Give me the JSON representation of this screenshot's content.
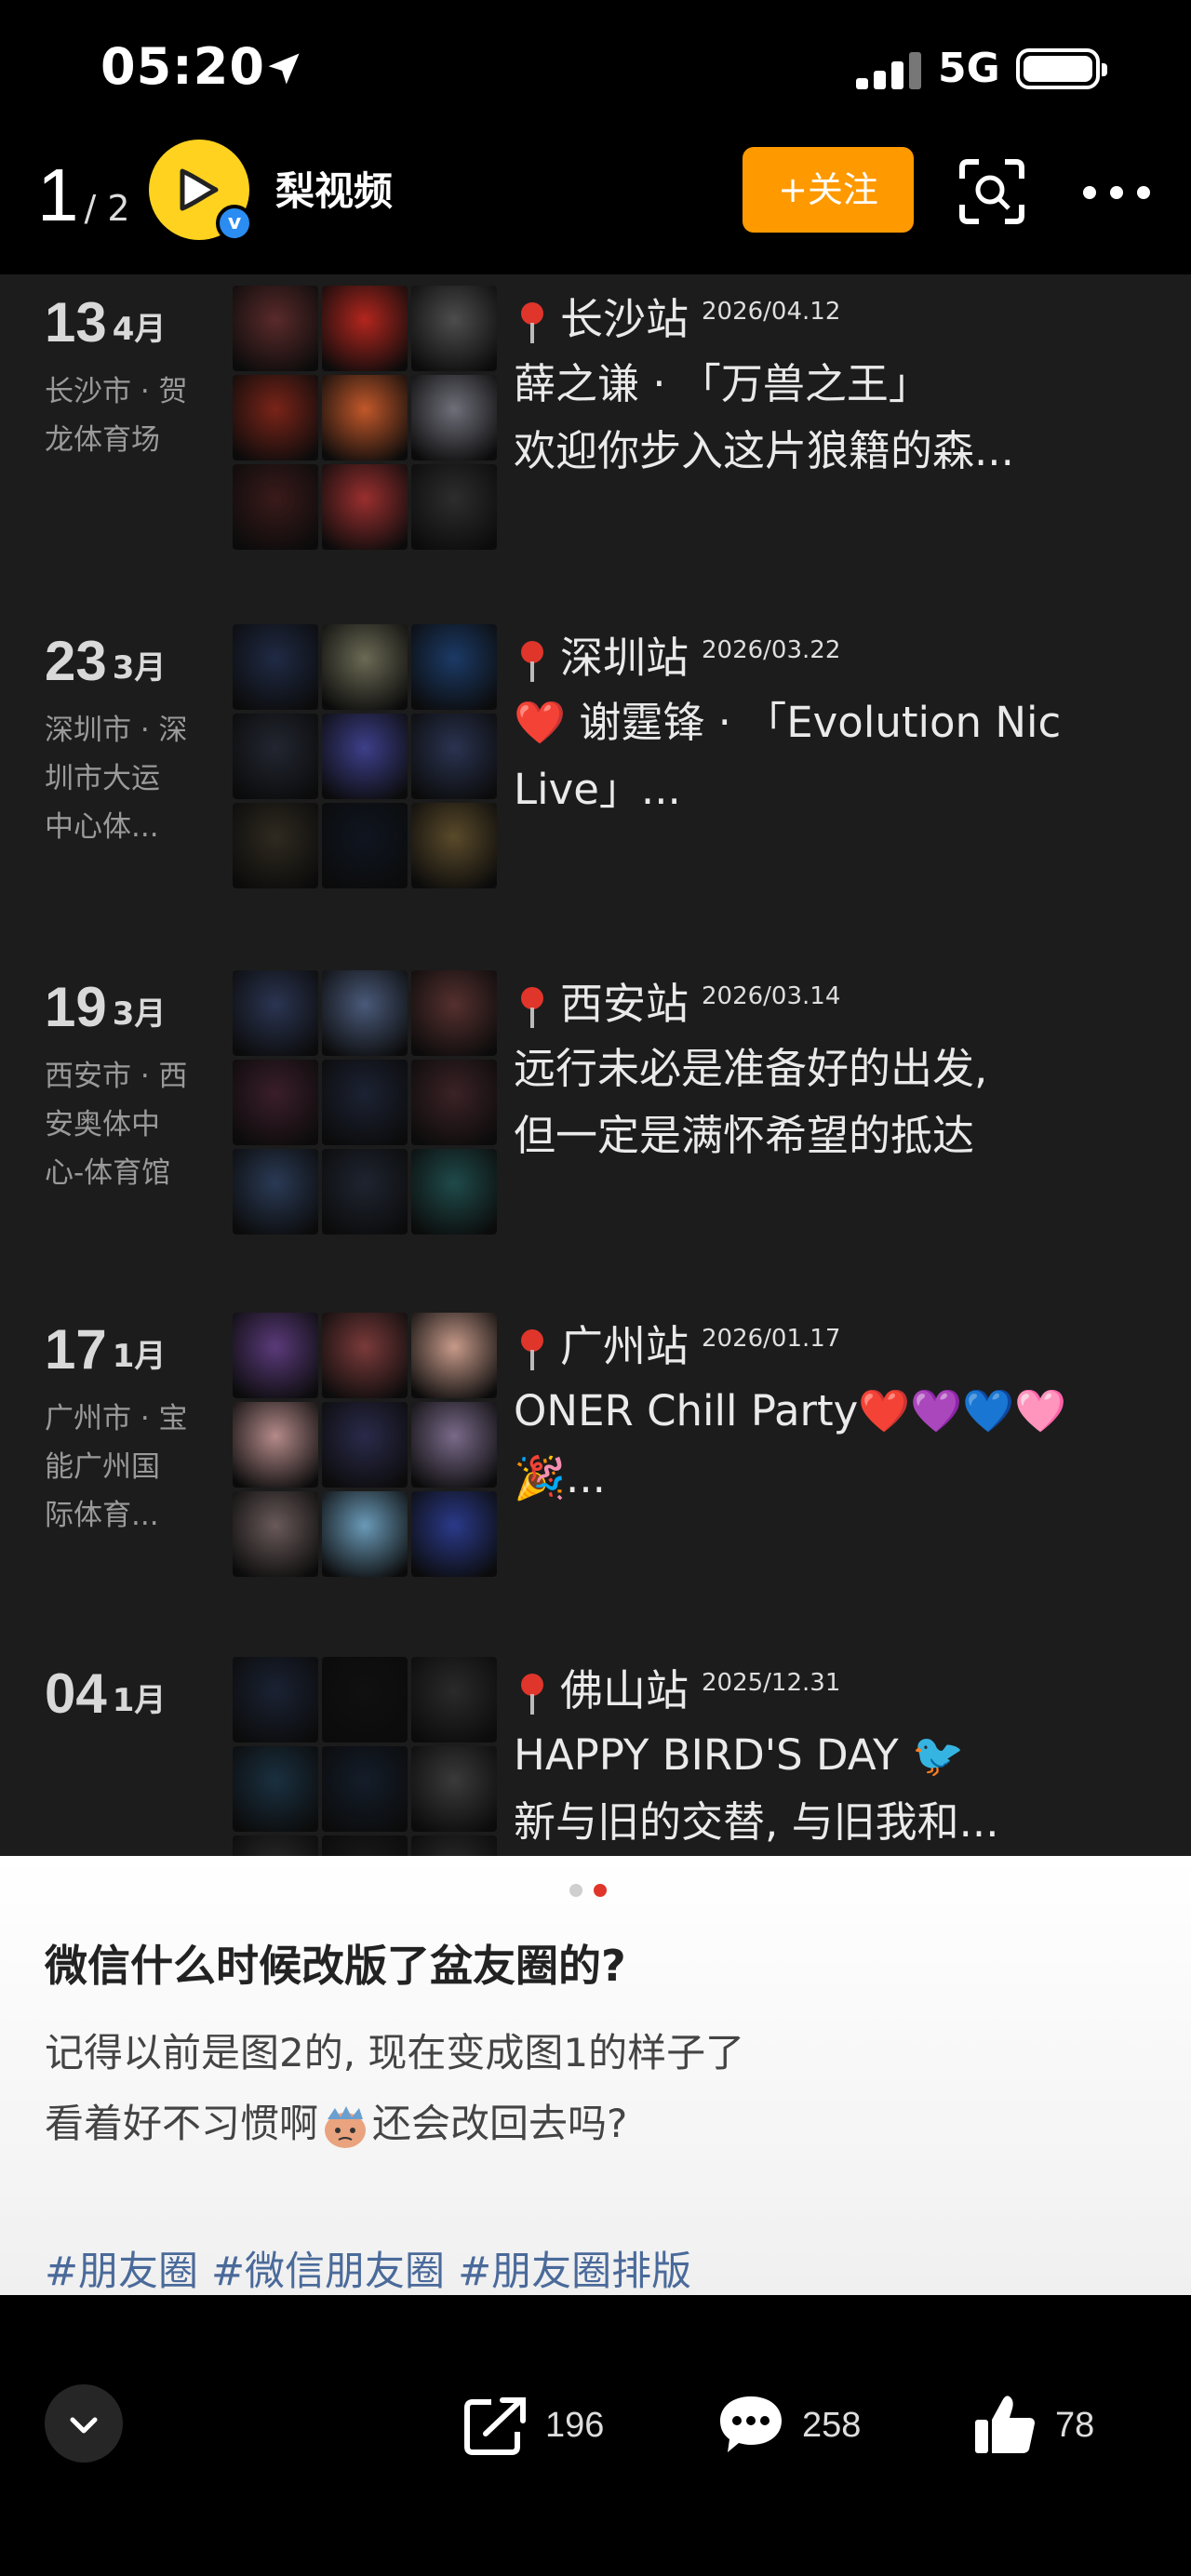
{
  "status_bar": {
    "time": "05:20",
    "network": "5G"
  },
  "header": {
    "page_current": "1",
    "page_total": "/ 2",
    "channel_name": "梨视频",
    "verified_mark": "v",
    "follow_label": "+关注"
  },
  "entries": [
    {
      "day": "13",
      "month": "4月",
      "venue": [
        "长沙市 · 贺",
        "龙体育场"
      ],
      "city_label": "长沙站",
      "stamp": "2026/04.12",
      "lines": [
        "薛之谦 · 「万兽之王」",
        "欢迎你步入这片狼籍的森..."
      ],
      "colors": [
        "#5a2a2a",
        "#b3261e",
        "#4d4d4d",
        "#7a2418",
        "#c2582a",
        "#6f6f7a",
        "#3a1a1a",
        "#9a2f2f",
        "#2d2d2d"
      ]
    },
    {
      "day": "23",
      "month": "3月",
      "venue": [
        "深圳市 · 深",
        "圳市大运",
        "中心体..."
      ],
      "city_label": "深圳站",
      "stamp": "2026/03.22",
      "lines": [
        "❤️ 谢霆锋 · 「Evolution Nic",
        "Live」..."
      ],
      "colors": [
        "#1f2a44",
        "#6b6a55",
        "#1b3a66",
        "#222631",
        "#3d3f8a",
        "#2a3350",
        "#2f2a20",
        "#0f1520",
        "#5a4a2a"
      ]
    },
    {
      "day": "19",
      "month": "3月",
      "venue": [
        "西安市 · 西",
        "安奥体中",
        "心-体育馆"
      ],
      "city_label": "西安站",
      "stamp": "2026/03.14",
      "lines": [
        "远行未必是准备好的出发,",
        "但一定是满怀希望的抵达"
      ],
      "colors": [
        "#2b3552",
        "#4a5a7a",
        "#55302f",
        "#3a1e2a",
        "#1c2233",
        "#3b2226",
        "#2a3a55",
        "#1e2430",
        "#1f4a4a"
      ]
    },
    {
      "day": "17",
      "month": "1月",
      "venue": [
        "广州市 · 宝",
        "能广州国",
        "际体育..."
      ],
      "city_label": "广州站",
      "stamp": "2026/01.17",
      "lines": [
        "ONER Chill Party❤️💜💙🩷",
        "🎉..."
      ],
      "colors": [
        "#5a3a7a",
        "#7a3a3a",
        "#c79a8a",
        "#b58a8a",
        "#2a2a4a",
        "#7a6a8a",
        "#6a5a5a",
        "#6a9ab8",
        "#2a3a8a"
      ]
    },
    {
      "day": "04",
      "month": "1月",
      "venue": [],
      "city_label": "佛山站",
      "stamp": "2025/12.31",
      "lines": [
        "HAPPY BIRD'S DAY 🐦",
        "新与旧的交替, 与旧我和..."
      ],
      "colors": [
        "#1a2233",
        "#101010",
        "#2a2a2a",
        "#1a3040",
        "#141d2a",
        "#3a3a3a",
        "#2a2a2a",
        "#1a1a1a",
        "#2a2a2a"
      ]
    }
  ],
  "caption": {
    "title": "微信什么时候改版了盆友圈的?",
    "line1": "记得以前是图2的, 现在变成图1的样子了",
    "line2_before": "看着好不习惯啊",
    "line2_after": "还会改回去吗?",
    "hashtags": [
      "#朋友圈",
      "#微信朋友圈",
      "#朋友圈排版"
    ]
  },
  "actions": {
    "share_count": "196",
    "comment_count": "258",
    "like_count": "78"
  },
  "icons": {
    "location": "location-arrow-icon",
    "scan": "scan-icon",
    "more": "more-dots-icon",
    "pin": "pin-icon",
    "share": "share-icon",
    "comment": "comment-icon",
    "like": "thumbs-up-icon",
    "collapse": "chevron-down-icon"
  },
  "colors": {
    "accent": "#ff9900",
    "avatar": "#ffd21f",
    "verified": "#2b8cf2",
    "hashtag": "#4a6a9a"
  }
}
